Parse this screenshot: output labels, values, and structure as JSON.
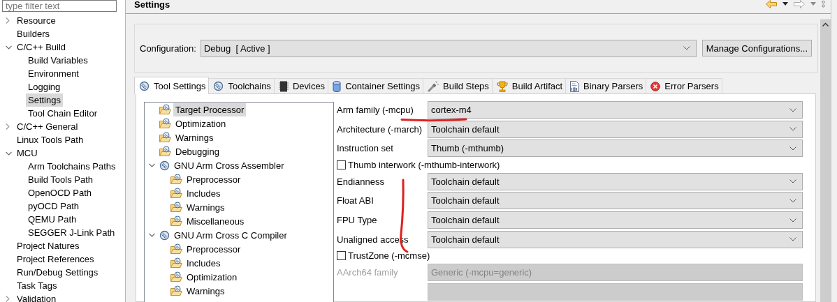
{
  "filter": {
    "placeholder": "type filter text"
  },
  "nav_tree": [
    {
      "label": "Resource",
      "expanded": false,
      "selected": false
    },
    {
      "label": "Builders",
      "selected": false
    },
    {
      "label": "C/C++ Build",
      "expanded": true,
      "selected": false,
      "children": [
        {
          "label": "Build Variables",
          "selected": false
        },
        {
          "label": "Environment",
          "selected": false
        },
        {
          "label": "Logging",
          "selected": false
        },
        {
          "label": "Settings",
          "selected": true
        },
        {
          "label": "Tool Chain Editor",
          "selected": false
        }
      ]
    },
    {
      "label": "C/C++ General",
      "expanded": false,
      "selected": false
    },
    {
      "label": "Linux Tools Path",
      "selected": false
    },
    {
      "label": "MCU",
      "expanded": true,
      "selected": false,
      "children": [
        {
          "label": "Arm Toolchains Paths",
          "selected": false
        },
        {
          "label": "Build Tools Path",
          "selected": false
        },
        {
          "label": "OpenOCD Path",
          "selected": false
        },
        {
          "label": "pyOCD Path",
          "selected": false
        },
        {
          "label": "QEMU Path",
          "selected": false
        },
        {
          "label": "SEGGER J-Link Path",
          "selected": false
        }
      ]
    },
    {
      "label": "Project Natures",
      "selected": false
    },
    {
      "label": "Project References",
      "selected": false
    },
    {
      "label": "Run/Debug Settings",
      "selected": false
    },
    {
      "label": "Task Tags",
      "selected": false
    },
    {
      "label": "Validation",
      "expanded": false,
      "selected": false
    }
  ],
  "page_title": "Settings",
  "configuration": {
    "label": "Configuration:",
    "value": "Debug  [ Active ]",
    "button": "Manage Configurations..."
  },
  "tabs": [
    {
      "label": "Tool Settings",
      "kind": "dial",
      "selected": true
    },
    {
      "label": "Toolchains",
      "kind": "dial",
      "selected": false
    },
    {
      "label": "Devices",
      "kind": "chip",
      "selected": false
    },
    {
      "label": "Container Settings",
      "kind": "cylinder",
      "selected": false
    },
    {
      "label": "Build Steps",
      "kind": "spray",
      "selected": false
    },
    {
      "label": "Build Artifact",
      "kind": "trophy",
      "selected": false
    },
    {
      "label": "Binary Parsers",
      "kind": "document",
      "selected": false
    },
    {
      "label": "Error Parsers",
      "kind": "error",
      "selected": false
    }
  ],
  "tool_tree": [
    {
      "label": "Target Processor",
      "selected": true
    },
    {
      "label": "Optimization",
      "selected": false
    },
    {
      "label": "Warnings",
      "selected": false
    },
    {
      "label": "Debugging",
      "selected": false
    },
    {
      "label": "GNU Arm Cross Assembler",
      "expanded": true,
      "selected": false,
      "children": [
        {
          "label": "Preprocessor",
          "selected": false
        },
        {
          "label": "Includes",
          "selected": false
        },
        {
          "label": "Warnings",
          "selected": false
        },
        {
          "label": "Miscellaneous",
          "selected": false
        }
      ]
    },
    {
      "label": "GNU Arm Cross C Compiler",
      "expanded": true,
      "selected": false,
      "children": [
        {
          "label": "Preprocessor",
          "selected": false
        },
        {
          "label": "Includes",
          "selected": false
        },
        {
          "label": "Optimization",
          "selected": false
        },
        {
          "label": "Warnings",
          "selected": false
        }
      ]
    }
  ],
  "options": [
    {
      "kind": "select",
      "label": "Arm family (-mcpu)",
      "value": "cortex-m4",
      "disabled": false
    },
    {
      "kind": "select",
      "label": "Architecture (-march)",
      "value": "Toolchain default",
      "disabled": false
    },
    {
      "kind": "select",
      "label": "Instruction set",
      "value": "Thumb (-mthumb)",
      "disabled": false
    },
    {
      "kind": "checkbox",
      "label": "Thumb interwork (-mthumb-interwork)",
      "checked": false
    },
    {
      "kind": "select",
      "label": "Endianness",
      "value": "Toolchain default",
      "disabled": false
    },
    {
      "kind": "select",
      "label": "Float ABI",
      "value": "Toolchain default",
      "disabled": false
    },
    {
      "kind": "select",
      "label": "FPU Type",
      "value": "Toolchain default",
      "disabled": false
    },
    {
      "kind": "select",
      "label": "Unaligned access",
      "value": "Toolchain default",
      "disabled": false
    },
    {
      "kind": "checkbox",
      "label": "TrustZone (-mcmse)",
      "checked": false
    },
    {
      "kind": "select",
      "label": "AArch64 family",
      "value": "Generic (-mcpu=generic)",
      "disabled": true
    },
    {
      "kind": "select",
      "disabled": true
    }
  ]
}
